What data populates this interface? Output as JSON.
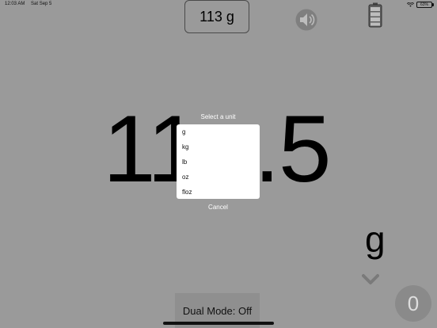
{
  "status_bar": {
    "time": "12:03 AM",
    "date": "Sat Sep 5",
    "battery_percent": "63%"
  },
  "header": {
    "weight_display": "113 g",
    "speaker_icon": "speaker-icon",
    "battery_icon": "battery-icon"
  },
  "main": {
    "reading_left": "11",
    "reading_right": ".5"
  },
  "unit_dialog": {
    "title": "Select a unit",
    "options": [
      "g",
      "kg",
      "lb",
      "oz",
      "floz"
    ],
    "cancel_label": "Cancel"
  },
  "unit_label": "g",
  "tare_button_label": "0",
  "dual_mode_label": "Dual Mode: Off",
  "colors": {
    "background": "#9a9a9a",
    "picker_bg": "#ffffff",
    "text": "#000000"
  }
}
